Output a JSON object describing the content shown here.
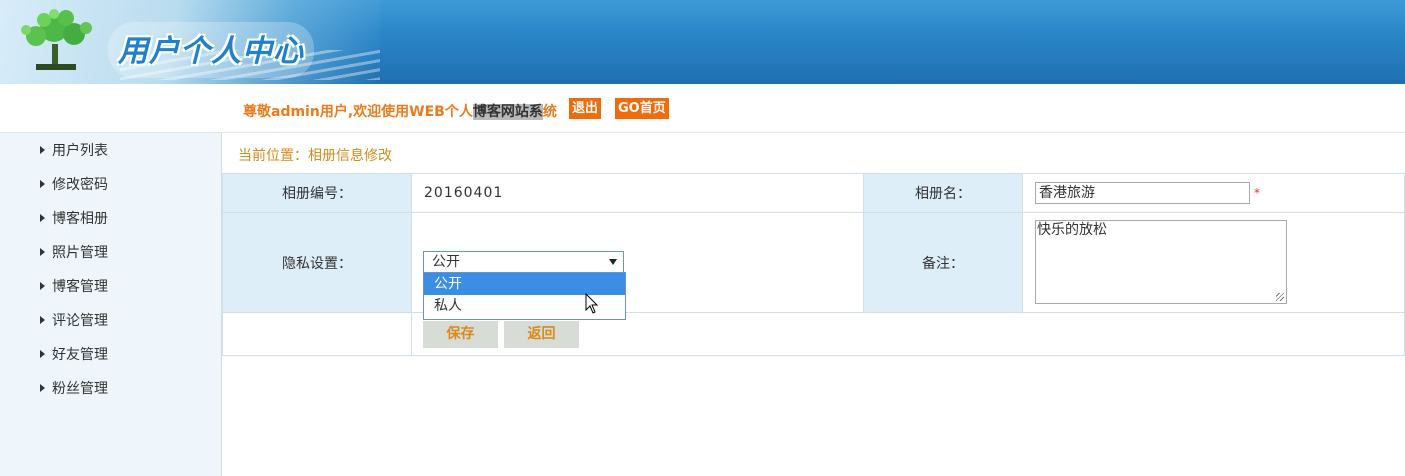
{
  "header": {
    "logo_title": "用户个人中心",
    "logo_icon": "tree-logo-icon"
  },
  "welcome": {
    "prefix": "尊敬admin用户,欢迎使用WEB个人",
    "highlight": "博客网站系",
    "suffix": "统",
    "logout_label": "退出",
    "home_label": "GO首页"
  },
  "sidebar": {
    "items": [
      {
        "label": "用户列表"
      },
      {
        "label": "修改密码"
      },
      {
        "label": "博客相册"
      },
      {
        "label": "照片管理"
      },
      {
        "label": "博客管理"
      },
      {
        "label": "评论管理"
      },
      {
        "label": "好友管理"
      },
      {
        "label": "粉丝管理"
      }
    ]
  },
  "breadcrumb": "当前位置：相册信息修改",
  "form": {
    "album_id_label": "相册编号：",
    "album_id_value": "20160401",
    "album_name_label": "相册名：",
    "album_name_value": "香港旅游",
    "required_mark": "*",
    "privacy_label": "隐私设置：",
    "privacy_selected": "公开",
    "privacy_options": [
      "公开",
      "私人"
    ],
    "note_label": "备注：",
    "note_value": "快乐的放松",
    "save_label": "保存",
    "back_label": "返回"
  },
  "colors": {
    "banner_blue": "#2a86c8",
    "welcome_orange": "#f07a1a",
    "button_orange": "#f26a0a",
    "label_bg": "#deeef8",
    "sidebar_bg": "#eef5fb",
    "select_highlight": "#3a8ee6"
  }
}
